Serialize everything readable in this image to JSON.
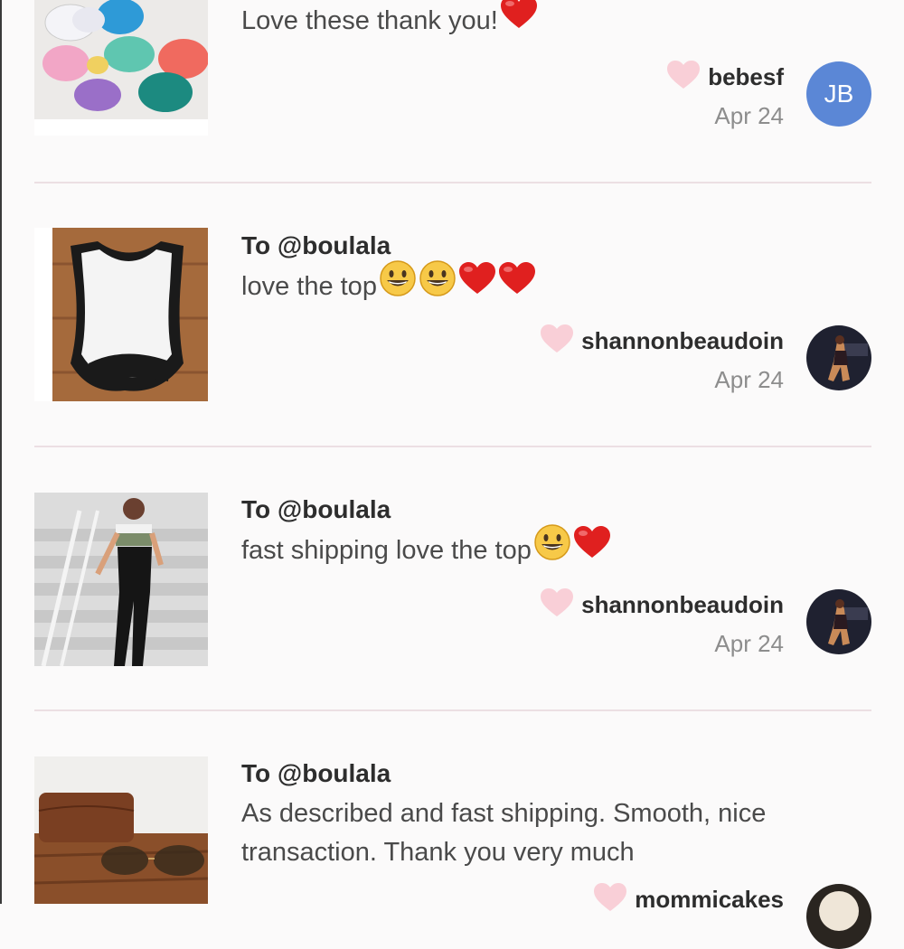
{
  "reviews": [
    {
      "to": "",
      "comment": "Love these thank you!",
      "author": "bebesf",
      "date": "Apr 24",
      "avatar_initials": "JB",
      "thumbnail": "hair-bows-photo"
    },
    {
      "to": "To @boulala",
      "comment": "love the top",
      "author": "shannonbeaudoin",
      "date": "Apr 24",
      "thumbnail": "white-crop-top-photo"
    },
    {
      "to": "To @boulala",
      "comment": "fast shipping love the top",
      "author": "shannonbeaudoin",
      "date": "Apr 24",
      "thumbnail": "model-bleachers-photo"
    },
    {
      "to": "To @boulala",
      "comment": "As described and fast shipping. Smooth, nice transaction. Thank you very much",
      "author": "mommicakes",
      "thumbnail": "sunglasses-case-photo"
    }
  ],
  "colors": {
    "heart": "#f9cfd7",
    "avatar_bg": "#5b87d6",
    "divider": "#ecdfe3"
  }
}
